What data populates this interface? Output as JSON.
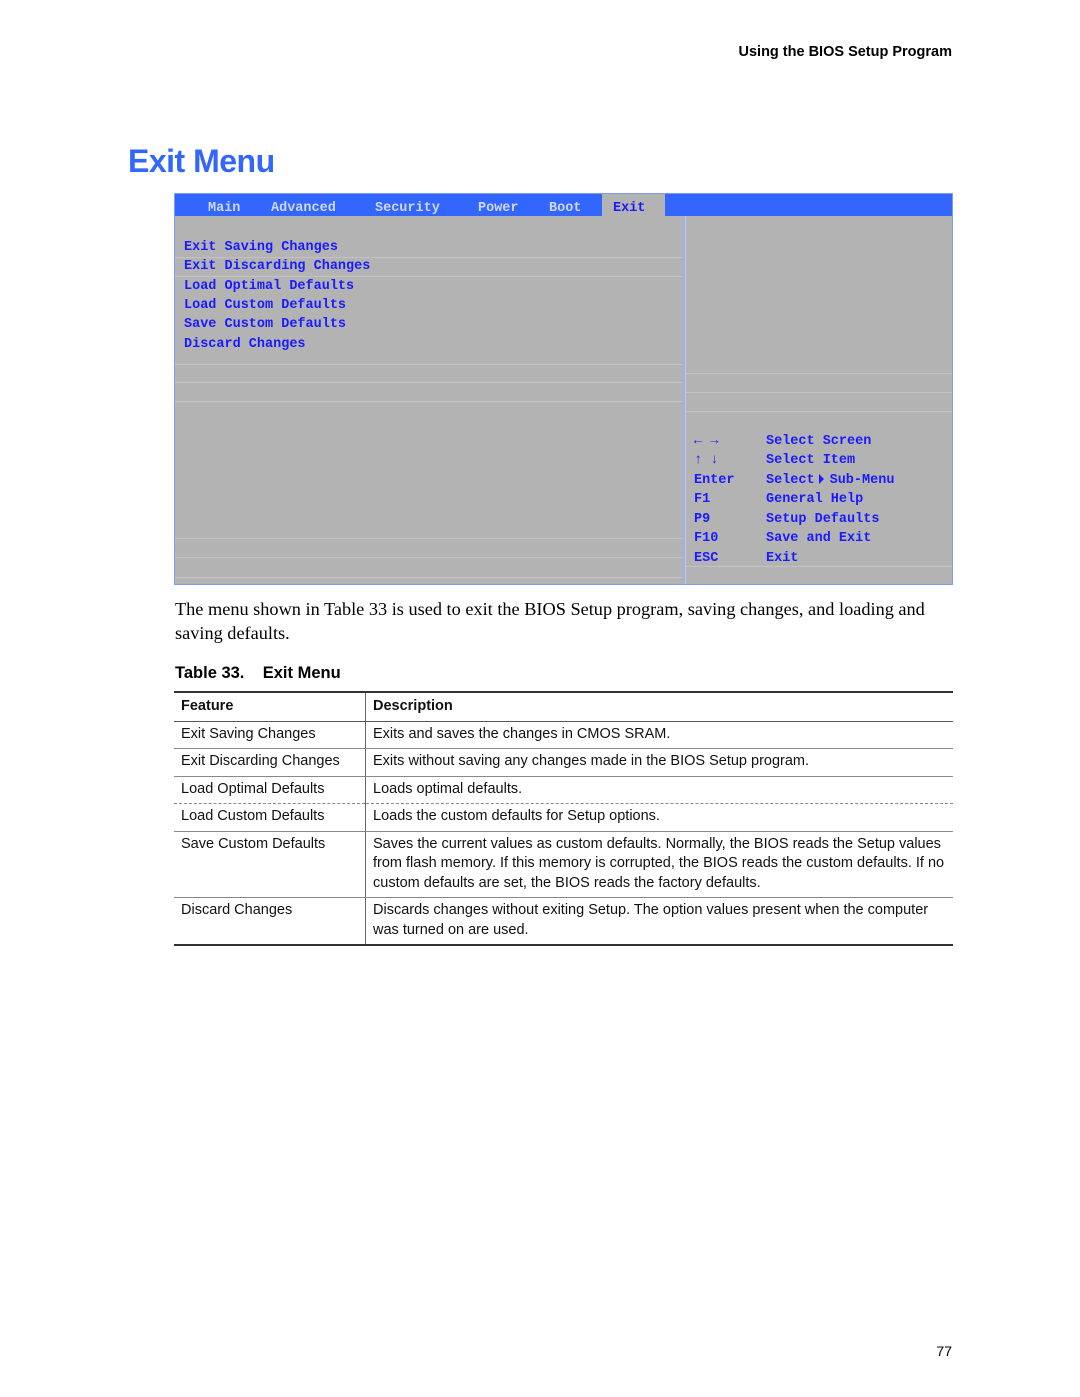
{
  "header": {
    "running_title": "Using the BIOS Setup Program"
  },
  "page_title": "Exit Menu",
  "bios_screen": {
    "tabs": [
      {
        "label": "Main",
        "active": false
      },
      {
        "label": "Advanced",
        "active": false
      },
      {
        "label": "Security",
        "active": false
      },
      {
        "label": "Power",
        "active": false
      },
      {
        "label": "Boot",
        "active": false
      },
      {
        "label": "Exit",
        "active": true
      }
    ],
    "menu_items": [
      "Exit Saving Changes",
      "Exit Discarding Changes",
      "Load Optimal Defaults",
      "Load Custom Defaults",
      "Save Custom Defaults",
      "Discard Changes"
    ],
    "key_help": [
      {
        "key": "← →",
        "action": "Select Screen"
      },
      {
        "key": "↑ ↓",
        "action": "Select Item"
      },
      {
        "key": "Enter",
        "action_pre": "Select",
        "action_post": "Sub-Menu",
        "icon": "triangle-right-icon"
      },
      {
        "key": "F1",
        "action": "General Help"
      },
      {
        "key": "P9",
        "action": "Setup Defaults"
      },
      {
        "key": "F10",
        "action": "Save and Exit"
      },
      {
        "key": "ESC",
        "action": "Exit"
      }
    ],
    "colors": {
      "tab_bar": "#3366ff",
      "background": "#b3b3b3",
      "text": "#1a1aff"
    }
  },
  "intro_text": "The menu shown in Table 33 is used to exit the BIOS Setup program, saving changes, and loading and saving defaults.",
  "table": {
    "caption_number": "Table 33.",
    "caption_title": "Exit Menu",
    "columns": [
      "Feature",
      "Description"
    ],
    "rows": [
      {
        "feature": "Exit Saving Changes",
        "description": "Exits and saves the changes in CMOS SRAM."
      },
      {
        "feature": "Exit Discarding Changes",
        "description": "Exits without saving any changes made in the BIOS Setup program."
      },
      {
        "feature": "Load Optimal Defaults",
        "description": "Loads optimal defaults."
      },
      {
        "feature": "Load Custom Defaults",
        "description": "Loads the custom defaults for Setup options."
      },
      {
        "feature": "Save Custom Defaults",
        "description": "Saves the current values as custom defaults.  Normally, the BIOS reads the Setup values from flash memory.  If this memory is corrupted, the BIOS reads the custom defaults.  If no custom defaults are set, the BIOS reads the factory defaults."
      },
      {
        "feature": "Discard Changes",
        "description": "Discards changes without exiting Setup.  The option values present when the computer was turned on are used."
      }
    ]
  },
  "page_number": "77",
  "colors": {
    "title_blue": "#3366ff"
  }
}
